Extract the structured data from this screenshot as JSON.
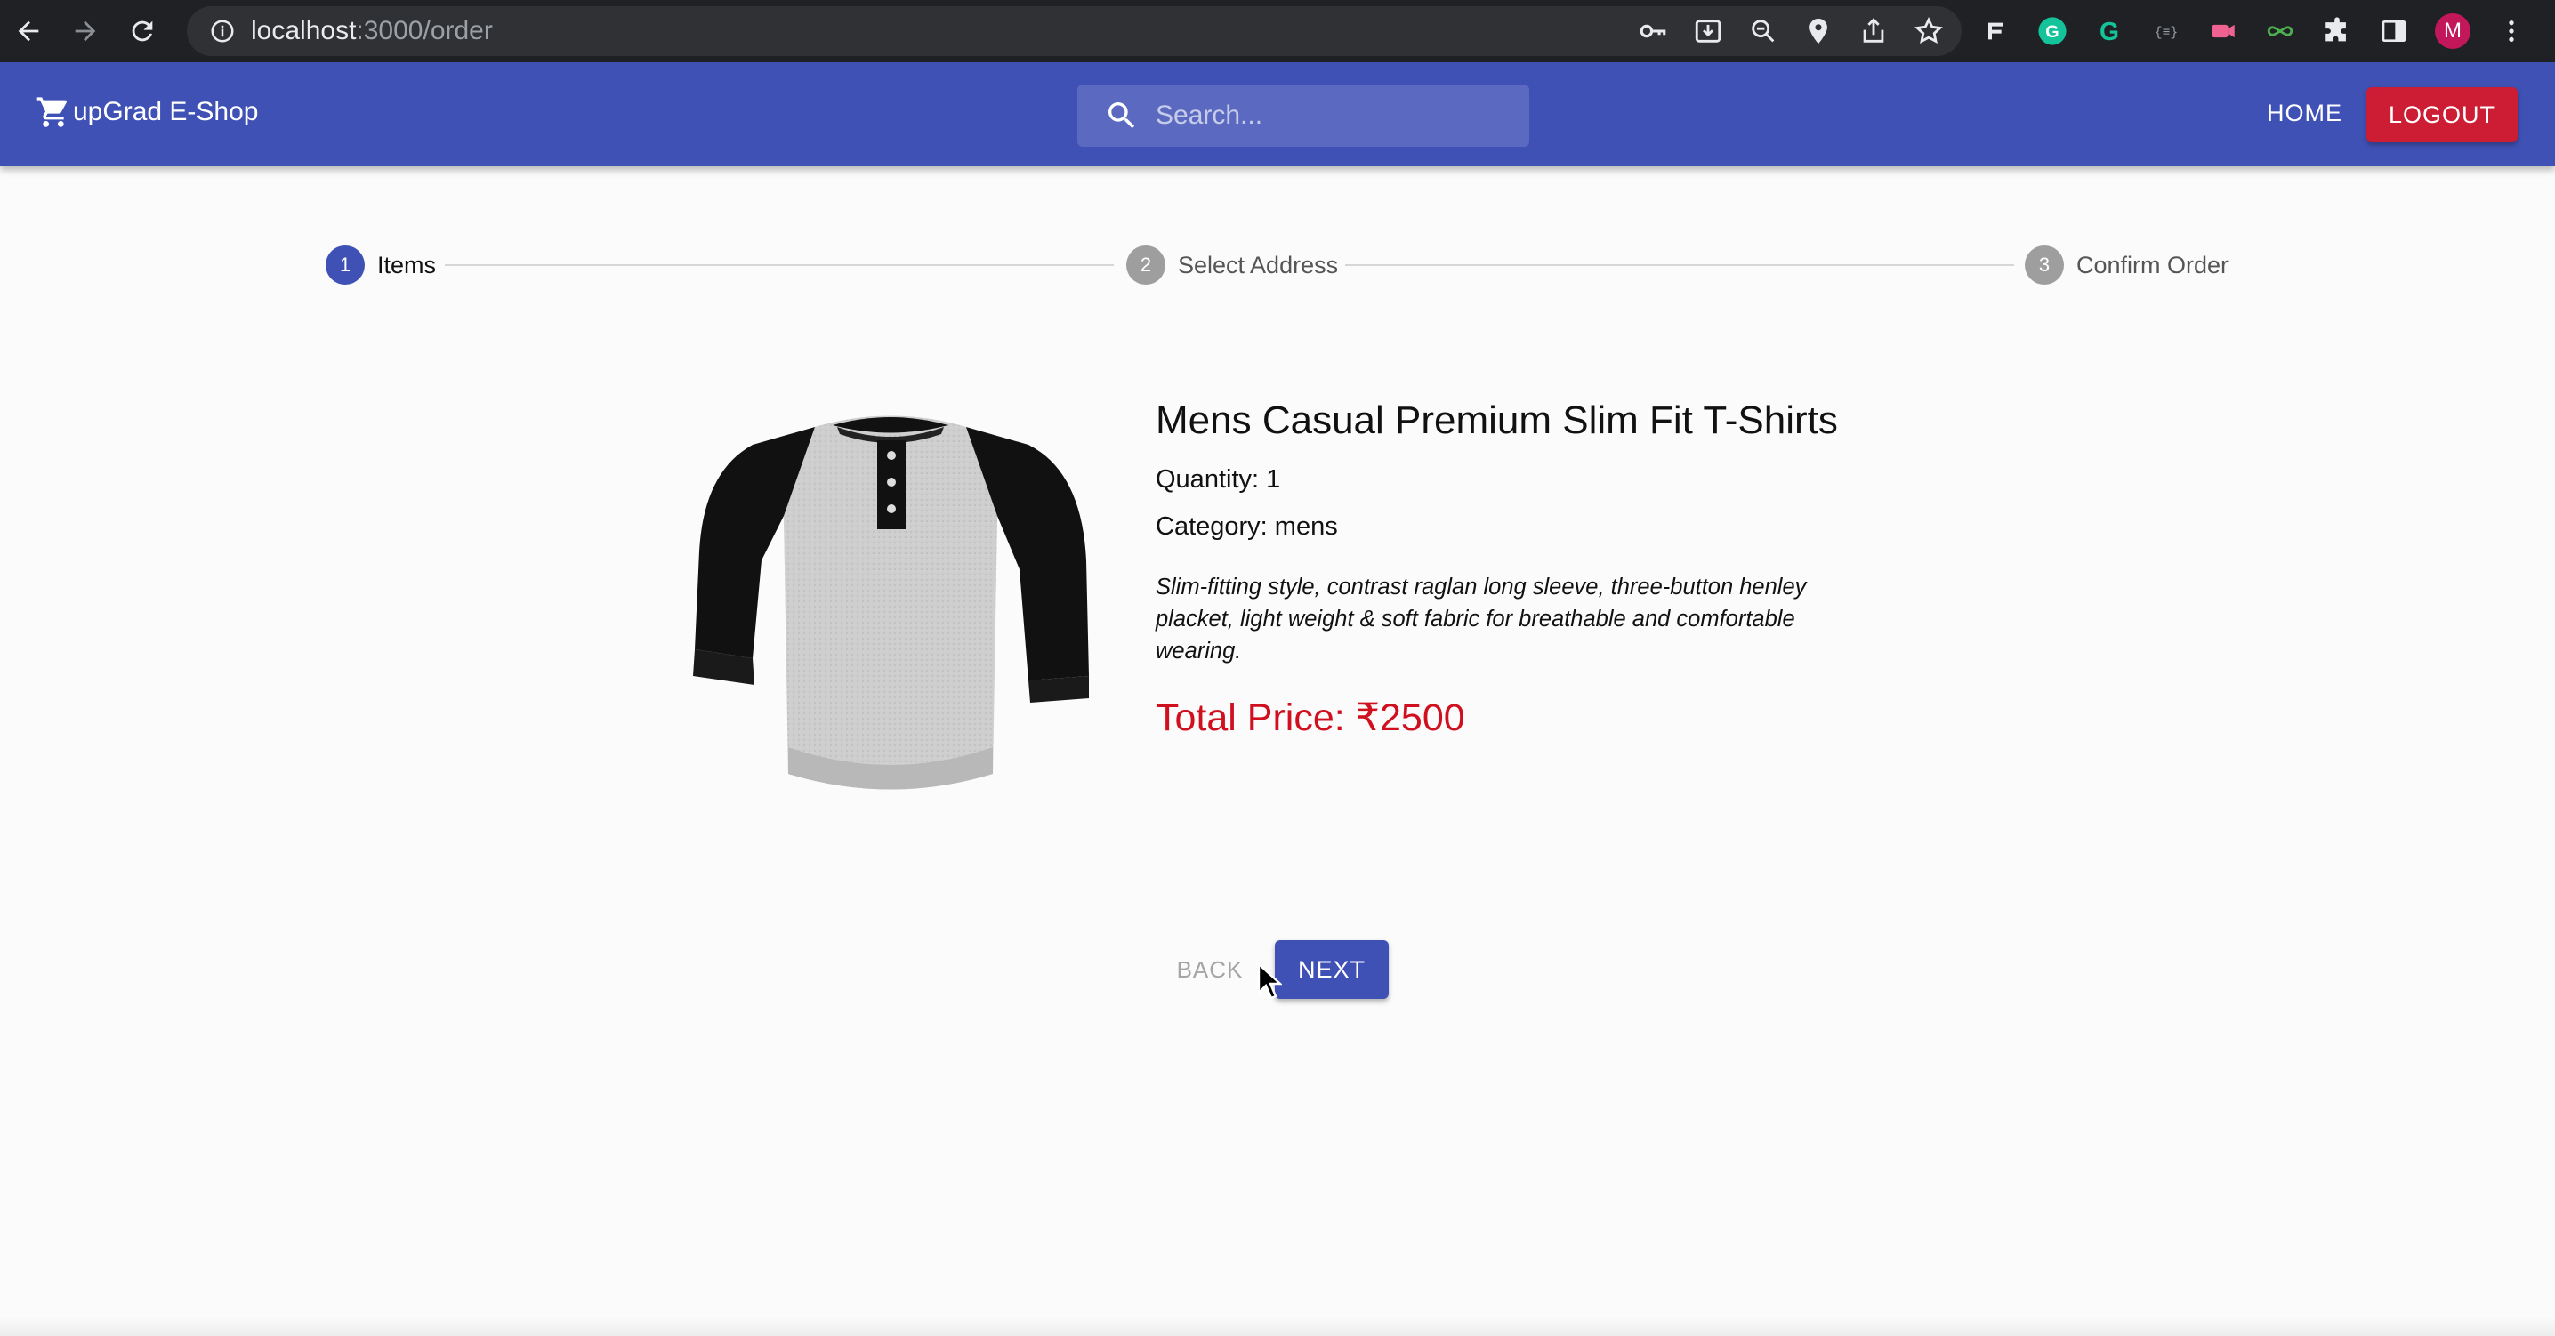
{
  "browser": {
    "url_host": "localhost",
    "url_path": ":3000/order",
    "profile_initial": "M"
  },
  "appbar": {
    "brand": "upGrad E-Shop",
    "search_placeholder": "Search...",
    "home_label": "HOME",
    "logout_label": "LOGOUT",
    "color": "#3f51b5"
  },
  "stepper": {
    "steps": [
      {
        "number": "1",
        "label": "Items",
        "active": true
      },
      {
        "number": "2",
        "label": "Select Address",
        "active": false
      },
      {
        "number": "3",
        "label": "Confirm Order",
        "active": false
      }
    ]
  },
  "product": {
    "name": "Mens Casual Premium Slim Fit T-Shirts",
    "quantity": "Quantity: 1",
    "category": "Category: mens",
    "description": "Slim-fitting style, contrast raglan long sleeve, three-button henley placket, light weight & soft fabric for breathable and comfortable wearing.",
    "total_price": "Total Price: ₹2500",
    "price_color": "#d0101f"
  },
  "actions": {
    "back_label": "BACK",
    "next_label": "NEXT"
  }
}
